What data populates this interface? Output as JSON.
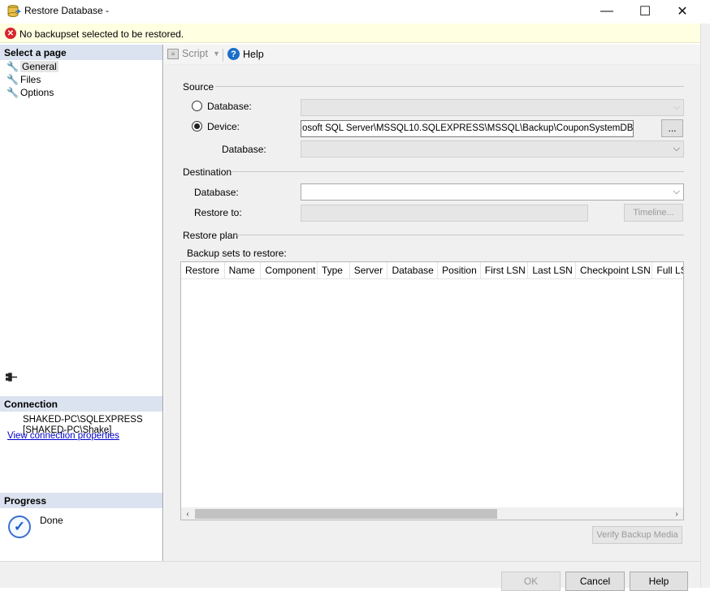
{
  "window": {
    "title": "Restore Database -",
    "minimize_label": "—",
    "maximize_label": "☐",
    "close_label": "✕"
  },
  "error": {
    "message": "No backupset selected to be restored."
  },
  "left_panel": {
    "select_page_header": "Select a page",
    "pages": [
      {
        "label": "General",
        "selected": true
      },
      {
        "label": "Files",
        "selected": false
      },
      {
        "label": "Options",
        "selected": false
      }
    ],
    "connection_header": "Connection",
    "connection_server": "SHAKED-PC\\SQLEXPRESS",
    "connection_user": "[SHAKED-PC\\Shake]",
    "view_connection_link": "View connection properties",
    "progress_header": "Progress",
    "progress_status": "Done"
  },
  "toolbar": {
    "script_label": "Script",
    "help_label": "Help"
  },
  "source": {
    "group_label": "Source",
    "database_radio_label": "Database:",
    "database_radio_selected": false,
    "device_radio_label": "Device:",
    "device_radio_selected": true,
    "device_path": "osoft SQL Server\\MSSQL10.SQLEXPRESS\\MSSQL\\Backup\\CouponSystemDB.bak",
    "browse_button_label": "...",
    "device_database_label": "Database:"
  },
  "destination": {
    "group_label": "Destination",
    "database_label": "Database:",
    "database_value": "",
    "restore_to_label": "Restore to:",
    "restore_to_value": "",
    "timeline_button_label": "Timeline..."
  },
  "restore_plan": {
    "group_label": "Restore plan",
    "backup_sets_label": "Backup sets to restore:",
    "columns": [
      "Restore",
      "Name",
      "Component",
      "Type",
      "Server",
      "Database",
      "Position",
      "First LSN",
      "Last LSN",
      "Checkpoint LSN",
      "Full LS"
    ],
    "rows": [],
    "verify_button_label": "Verify Backup Media"
  },
  "buttons": {
    "ok_label": "OK",
    "cancel_label": "Cancel",
    "help_label": "Help"
  },
  "colors": {
    "error_bar_bg": "#ffffe1",
    "section_header_bg": "#dae3ef",
    "link": "#0000cc",
    "error_icon": "#d8252c"
  }
}
